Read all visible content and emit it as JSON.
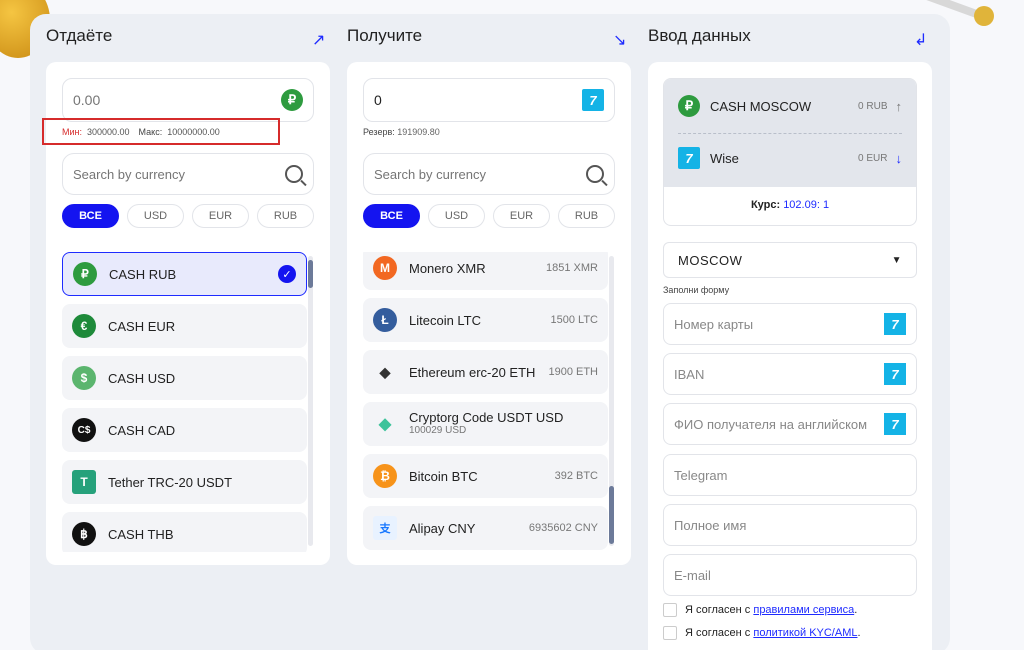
{
  "give": {
    "title": "Отдаёте",
    "amount_placeholder": "0.00",
    "limits": {
      "min_label": "Мин:",
      "min_value": "300000.00",
      "max_label": "Макс:",
      "max_value": "10000000.00"
    },
    "search_placeholder": "Search by currency",
    "filters": [
      "ВСЕ",
      "USD",
      "EUR",
      "RUB"
    ],
    "items": [
      {
        "name": "CASH RUB",
        "icon": "ruble-icon",
        "color": "#2e9b3f",
        "glyph": "₽"
      },
      {
        "name": "CASH EUR",
        "icon": "euro-icon",
        "color": "#1e8a3a",
        "glyph": "€"
      },
      {
        "name": "CASH USD",
        "icon": "dollar-icon",
        "color": "#5bb56e",
        "glyph": "$"
      },
      {
        "name": "CASH CAD",
        "icon": "cad-icon",
        "color": "#111111",
        "glyph": "C$"
      },
      {
        "name": "Tether TRC-20 USDT",
        "icon": "tether-icon",
        "color": "#26a17b",
        "glyph": "T"
      },
      {
        "name": "CASH THB",
        "icon": "baht-icon",
        "color": "#111111",
        "glyph": "฿"
      }
    ]
  },
  "receive": {
    "title": "Получите",
    "amount_value": "0",
    "reserve_label": "Резерв:",
    "reserve_value": "191909.80",
    "search_placeholder": "Search by currency",
    "filters": [
      "ВСЕ",
      "USD",
      "EUR",
      "RUB"
    ],
    "items": [
      {
        "name": "Monero XMR",
        "amount": "1851 XMR",
        "icon": "monero-icon",
        "color": "#f26822",
        "glyph": "M"
      },
      {
        "name": "Litecoin LTC",
        "amount": "1500 LTC",
        "icon": "litecoin-icon",
        "color": "#345d9d",
        "glyph": "Ł"
      },
      {
        "name": "Ethereum erc-20 ETH",
        "amount": "1900 ETH",
        "icon": "ethereum-icon",
        "color": "#ffffff",
        "glyph": "◆"
      },
      {
        "name": "Cryptorg Code USDT USD",
        "amount": "100029 USD",
        "icon": "cryptorg-icon",
        "color": "#ffffff",
        "glyph": "◆"
      },
      {
        "name": "Bitcoin BTC",
        "amount": "392 BTC",
        "icon": "bitcoin-icon",
        "color": "#f7931a",
        "glyph": "₿"
      },
      {
        "name": "Alipay CNY",
        "amount": "6935602 CNY",
        "icon": "alipay-icon",
        "color": "#ffffff",
        "glyph": "支"
      }
    ]
  },
  "details": {
    "title": "Ввод данных",
    "from_name": "CASH MOSCOW",
    "from_amount": "0 RUB",
    "to_name": "Wise",
    "to_amount": "0 EUR",
    "rate_label": "Курс:",
    "rate_value": "102.09: 1",
    "city": "MOSCOW",
    "form_hint": "Заполни форму",
    "fields": [
      {
        "placeholder": "Номер карты",
        "wise": true
      },
      {
        "placeholder": "IBAN",
        "wise": true
      },
      {
        "placeholder": "ФИО получателя на английском",
        "wise": true
      },
      {
        "placeholder": "Telegram",
        "wise": false
      },
      {
        "placeholder": "Полное имя",
        "wise": false
      },
      {
        "placeholder": "E-mail",
        "wise": false
      }
    ],
    "agree_rules_prefix": "Я согласен с",
    "agree_rules_link": "правилами сервиса",
    "agree_kyc_prefix": "Я согласен с",
    "agree_kyc_link": "политикой KYC/AML"
  },
  "colors": {
    "accent": "#1414f0",
    "limit_border": "#d62b2b",
    "rub_green": "#2e9b3f",
    "wise_blue": "#14b3e6"
  }
}
